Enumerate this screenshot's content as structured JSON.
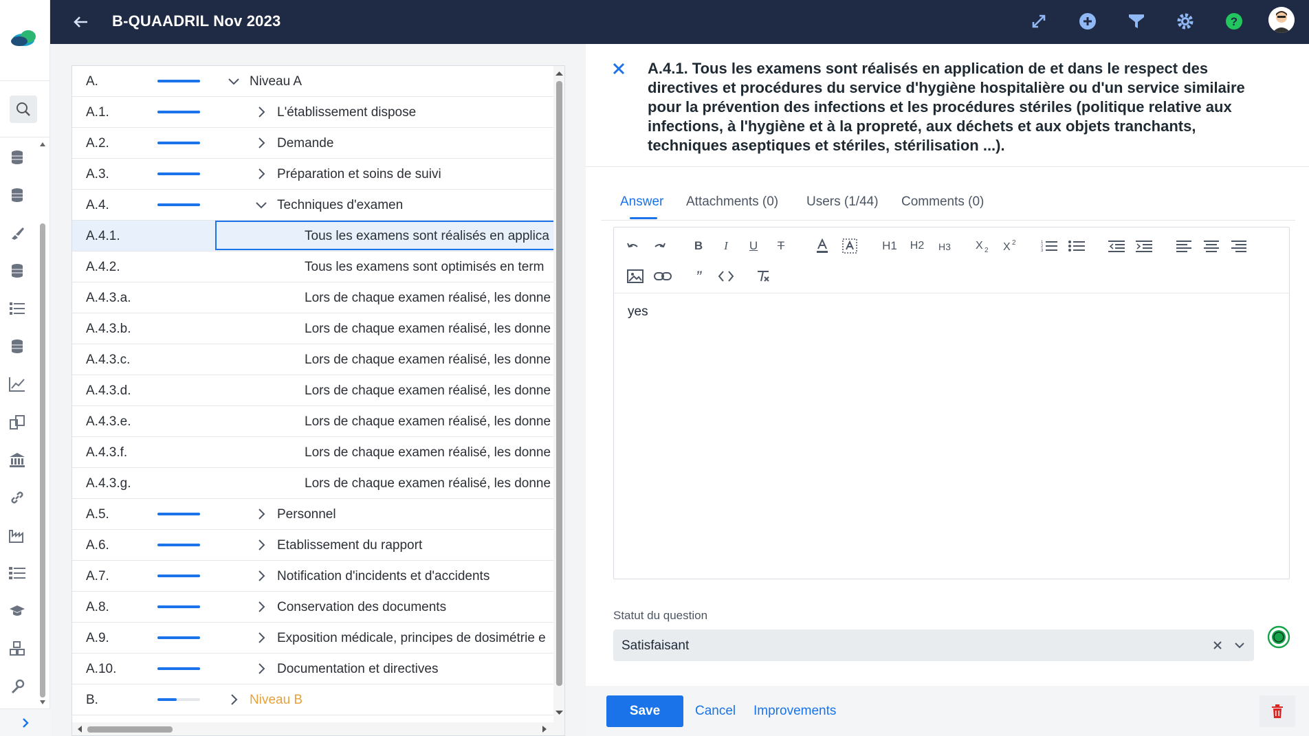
{
  "header": {
    "title": "B-QUAADRIL Nov 2023",
    "icons": [
      "back-arrow-icon",
      "expand-diagonal-icon",
      "add-circle-icon",
      "filter-icon",
      "gear-icon",
      "help-icon",
      "avatar"
    ]
  },
  "sidebar": {
    "icons": [
      "logo",
      "search-icon",
      "database-icon",
      "database-icon",
      "brush-icon",
      "database-icon",
      "list-icon",
      "database-icon",
      "chart-line-icon",
      "documents-icon",
      "bank-icon",
      "link-icon",
      "factory-icon",
      "list-check-icon",
      "graduation-cap-icon",
      "cubes-icon",
      "wrench-icon"
    ]
  },
  "tree": {
    "rows": [
      {
        "code": "A.",
        "label": "Niveau A",
        "progress": 1.0,
        "expanded": true,
        "level": 0
      },
      {
        "code": "A.1.",
        "label": "L'établissement dispose",
        "progress": 1.0,
        "expanded": false,
        "level": 1
      },
      {
        "code": "A.2.",
        "label": "Demande",
        "progress": 1.0,
        "expanded": false,
        "level": 1
      },
      {
        "code": "A.3.",
        "label": "Préparation et soins de suivi",
        "progress": 1.0,
        "expanded": false,
        "level": 1
      },
      {
        "code": "A.4.",
        "label": "Techniques d'examen",
        "progress": 1.0,
        "expanded": true,
        "level": 1
      },
      {
        "code": "A.4.1.",
        "label": "Tous les examens sont réalisés en applica",
        "level": 2,
        "selected": true
      },
      {
        "code": "A.4.2.",
        "label": "Tous les examens sont optimisés en term",
        "level": 2
      },
      {
        "code": "A.4.3.a.",
        "label": "Lors de chaque examen réalisé, les donne",
        "level": 2
      },
      {
        "code": "A.4.3.b.",
        "label": "Lors de chaque examen réalisé, les donne",
        "level": 2
      },
      {
        "code": "A.4.3.c.",
        "label": "Lors de chaque examen réalisé, les donne",
        "level": 2
      },
      {
        "code": "A.4.3.d.",
        "label": "Lors de chaque examen réalisé, les donne",
        "level": 2
      },
      {
        "code": "A.4.3.e.",
        "label": "Lors de chaque examen réalisé, les donne",
        "level": 2
      },
      {
        "code": "A.4.3.f.",
        "label": "Lors de chaque examen réalisé, les donne",
        "level": 2
      },
      {
        "code": "A.4.3.g.",
        "label": "Lors de chaque examen réalisé, les donne",
        "level": 2
      },
      {
        "code": "A.5.",
        "label": "Personnel",
        "progress": 1.0,
        "expanded": false,
        "level": 1
      },
      {
        "code": "A.6.",
        "label": "Etablissement du rapport",
        "progress": 1.0,
        "expanded": false,
        "level": 1
      },
      {
        "code": "A.7.",
        "label": "Notification d'incidents et d'accidents",
        "progress": 1.0,
        "expanded": false,
        "level": 1
      },
      {
        "code": "A.8.",
        "label": "Conservation des documents",
        "progress": 1.0,
        "expanded": false,
        "level": 1
      },
      {
        "code": "A.9.",
        "label": "Exposition médicale, principes de dosimétrie e",
        "progress": 1.0,
        "expanded": false,
        "level": 1
      },
      {
        "code": "A.10.",
        "label": "Documentation et directives",
        "progress": 1.0,
        "expanded": false,
        "level": 1
      },
      {
        "code": "B.",
        "label": "Niveau B",
        "progress": 0.45,
        "expanded": false,
        "level": 0,
        "accent": true
      }
    ]
  },
  "detail": {
    "title_lines": [
      "A.4.1. Tous les examens sont réalisés en application de et dans le respect des",
      "directives et procédures du service d'hygiène hospitalière ou d'un service similaire",
      "pour la prévention des infections et les procédures stériles (politique relative aux",
      "infections, à l'hygiène et à la propreté, aux déchets et aux objets tranchants,",
      "techniques aseptiques et stériles, stérilisation ...)."
    ],
    "tabs": [
      "Answer",
      "Attachments (0)",
      "Users (1/44)",
      "Comments (0)"
    ],
    "active_tab": "Answer",
    "toolbar": {
      "h1": "H1",
      "h2": "H2",
      "h3": "H3",
      "bold": "B",
      "italic": "I",
      "underline": "U",
      "strike": "T",
      "quote": "”"
    },
    "answer": "yes",
    "status_label": "Statut du question",
    "status_value": "Satisfaisant",
    "save": "Save",
    "cancel": "Cancel",
    "improvements": "Improvements"
  },
  "colors": {
    "header_bg": "#1f2a44",
    "accent": "#1a73e8",
    "orange": "#e8a13a",
    "success": "#16a34a",
    "danger": "#dc2626"
  }
}
